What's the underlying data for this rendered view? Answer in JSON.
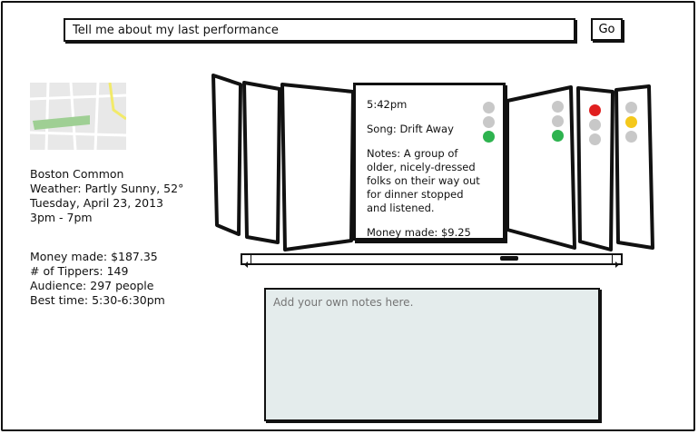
{
  "search": {
    "value": "Tell me about my last performance"
  },
  "go_label": "Go",
  "location": {
    "name": "Boston Common",
    "weather": "Weather: Partly Sunny, 52°",
    "date": "Tuesday, April 23, 2013",
    "time": "3pm - 7pm"
  },
  "stats": {
    "money": "Money made: $187.35",
    "tippers": "# of Tippers: 149",
    "audience": "Audience: 297 people",
    "best_time": "Best time: 5:30-6:30pm"
  },
  "featured_card": {
    "time": "5:42pm",
    "song": "Song: Drift Away",
    "notes": "Notes: A group of older, nicely-dressed folks on their way out for dinner stopped and listened.",
    "money": "Money made: $9.25",
    "lights": [
      "gray",
      "gray",
      "green"
    ]
  },
  "side_cards_lights": [
    [
      "gray",
      "gray",
      "green"
    ],
    [
      "red",
      "gray",
      "gray"
    ],
    [
      "gray",
      "yellow",
      "gray"
    ]
  ],
  "notes": {
    "placeholder": "Add your own notes here."
  },
  "colors": {
    "green": "#2eb34f",
    "red": "#e01f1f",
    "yellow": "#f4c81c",
    "gray": "#c8c8c8",
    "notes_bg": "#e4ecec",
    "map_park": "#9fcf94",
    "map_road": "#f2ea6a"
  }
}
